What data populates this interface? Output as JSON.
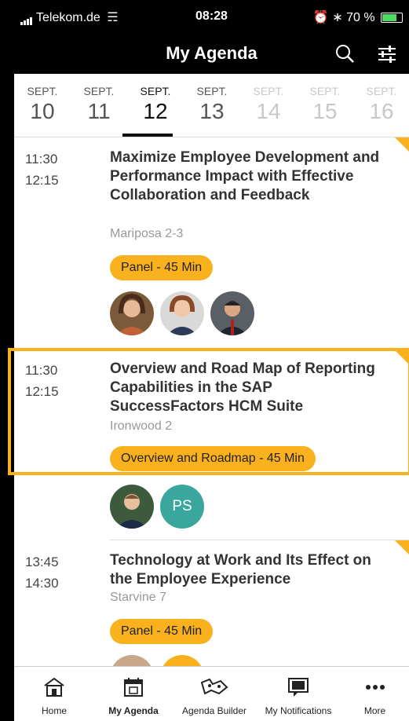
{
  "status_bar": {
    "carrier": "Telekom.de",
    "time": "08:28",
    "battery": "70 %"
  },
  "header": {
    "title": "My Agenda",
    "search_icon": "search-icon",
    "filter_icon": "sliders-icon"
  },
  "dates": [
    {
      "month": "SEPT.",
      "day": "10",
      "state": "normal"
    },
    {
      "month": "SEPT.",
      "day": "11",
      "state": "normal"
    },
    {
      "month": "SEPT.",
      "day": "12",
      "state": "active"
    },
    {
      "month": "SEPT.",
      "day": "13",
      "state": "normal"
    },
    {
      "month": "SEPT.",
      "day": "14",
      "state": "muted"
    },
    {
      "month": "SEPT.",
      "day": "15",
      "state": "muted"
    },
    {
      "month": "SEPT.",
      "day": "16",
      "state": "muted"
    }
  ],
  "sessions": [
    {
      "start": "11:30",
      "end": "12:15",
      "title": "Maximize Employee Development and Performance Impact with Effective Collaboration and Feedback",
      "location": "Mariposa 2-3",
      "tag": "Panel - 45 Min"
    },
    {
      "start": "11:30",
      "end": "12:15",
      "title": "Overview and Road Map of Reporting Capabilities in the SAP SuccessFactors HCM Suite",
      "location": "Ironwood 2",
      "tag": "Overview and Roadmap - 45 Min",
      "speaker_initials": "PS"
    },
    {
      "start": "13:45",
      "end": "14:30",
      "title": "Technology at Work and Its Effect on the Employee Experience",
      "location": "Starvine 7",
      "tag": "Panel - 45 Min"
    }
  ],
  "tabs": [
    {
      "label": "Home",
      "icon": "home-icon"
    },
    {
      "label": "My Agenda",
      "icon": "calendar-icon"
    },
    {
      "label": "Agenda Builder",
      "icon": "puzzle-icon"
    },
    {
      "label": "My Notifications",
      "icon": "chat-icon"
    },
    {
      "label": "More",
      "icon": "more-icon"
    }
  ],
  "colors": {
    "accent": "#f9b21d",
    "header_bg": "#000000",
    "initials_avatar": "#3aa79e"
  }
}
